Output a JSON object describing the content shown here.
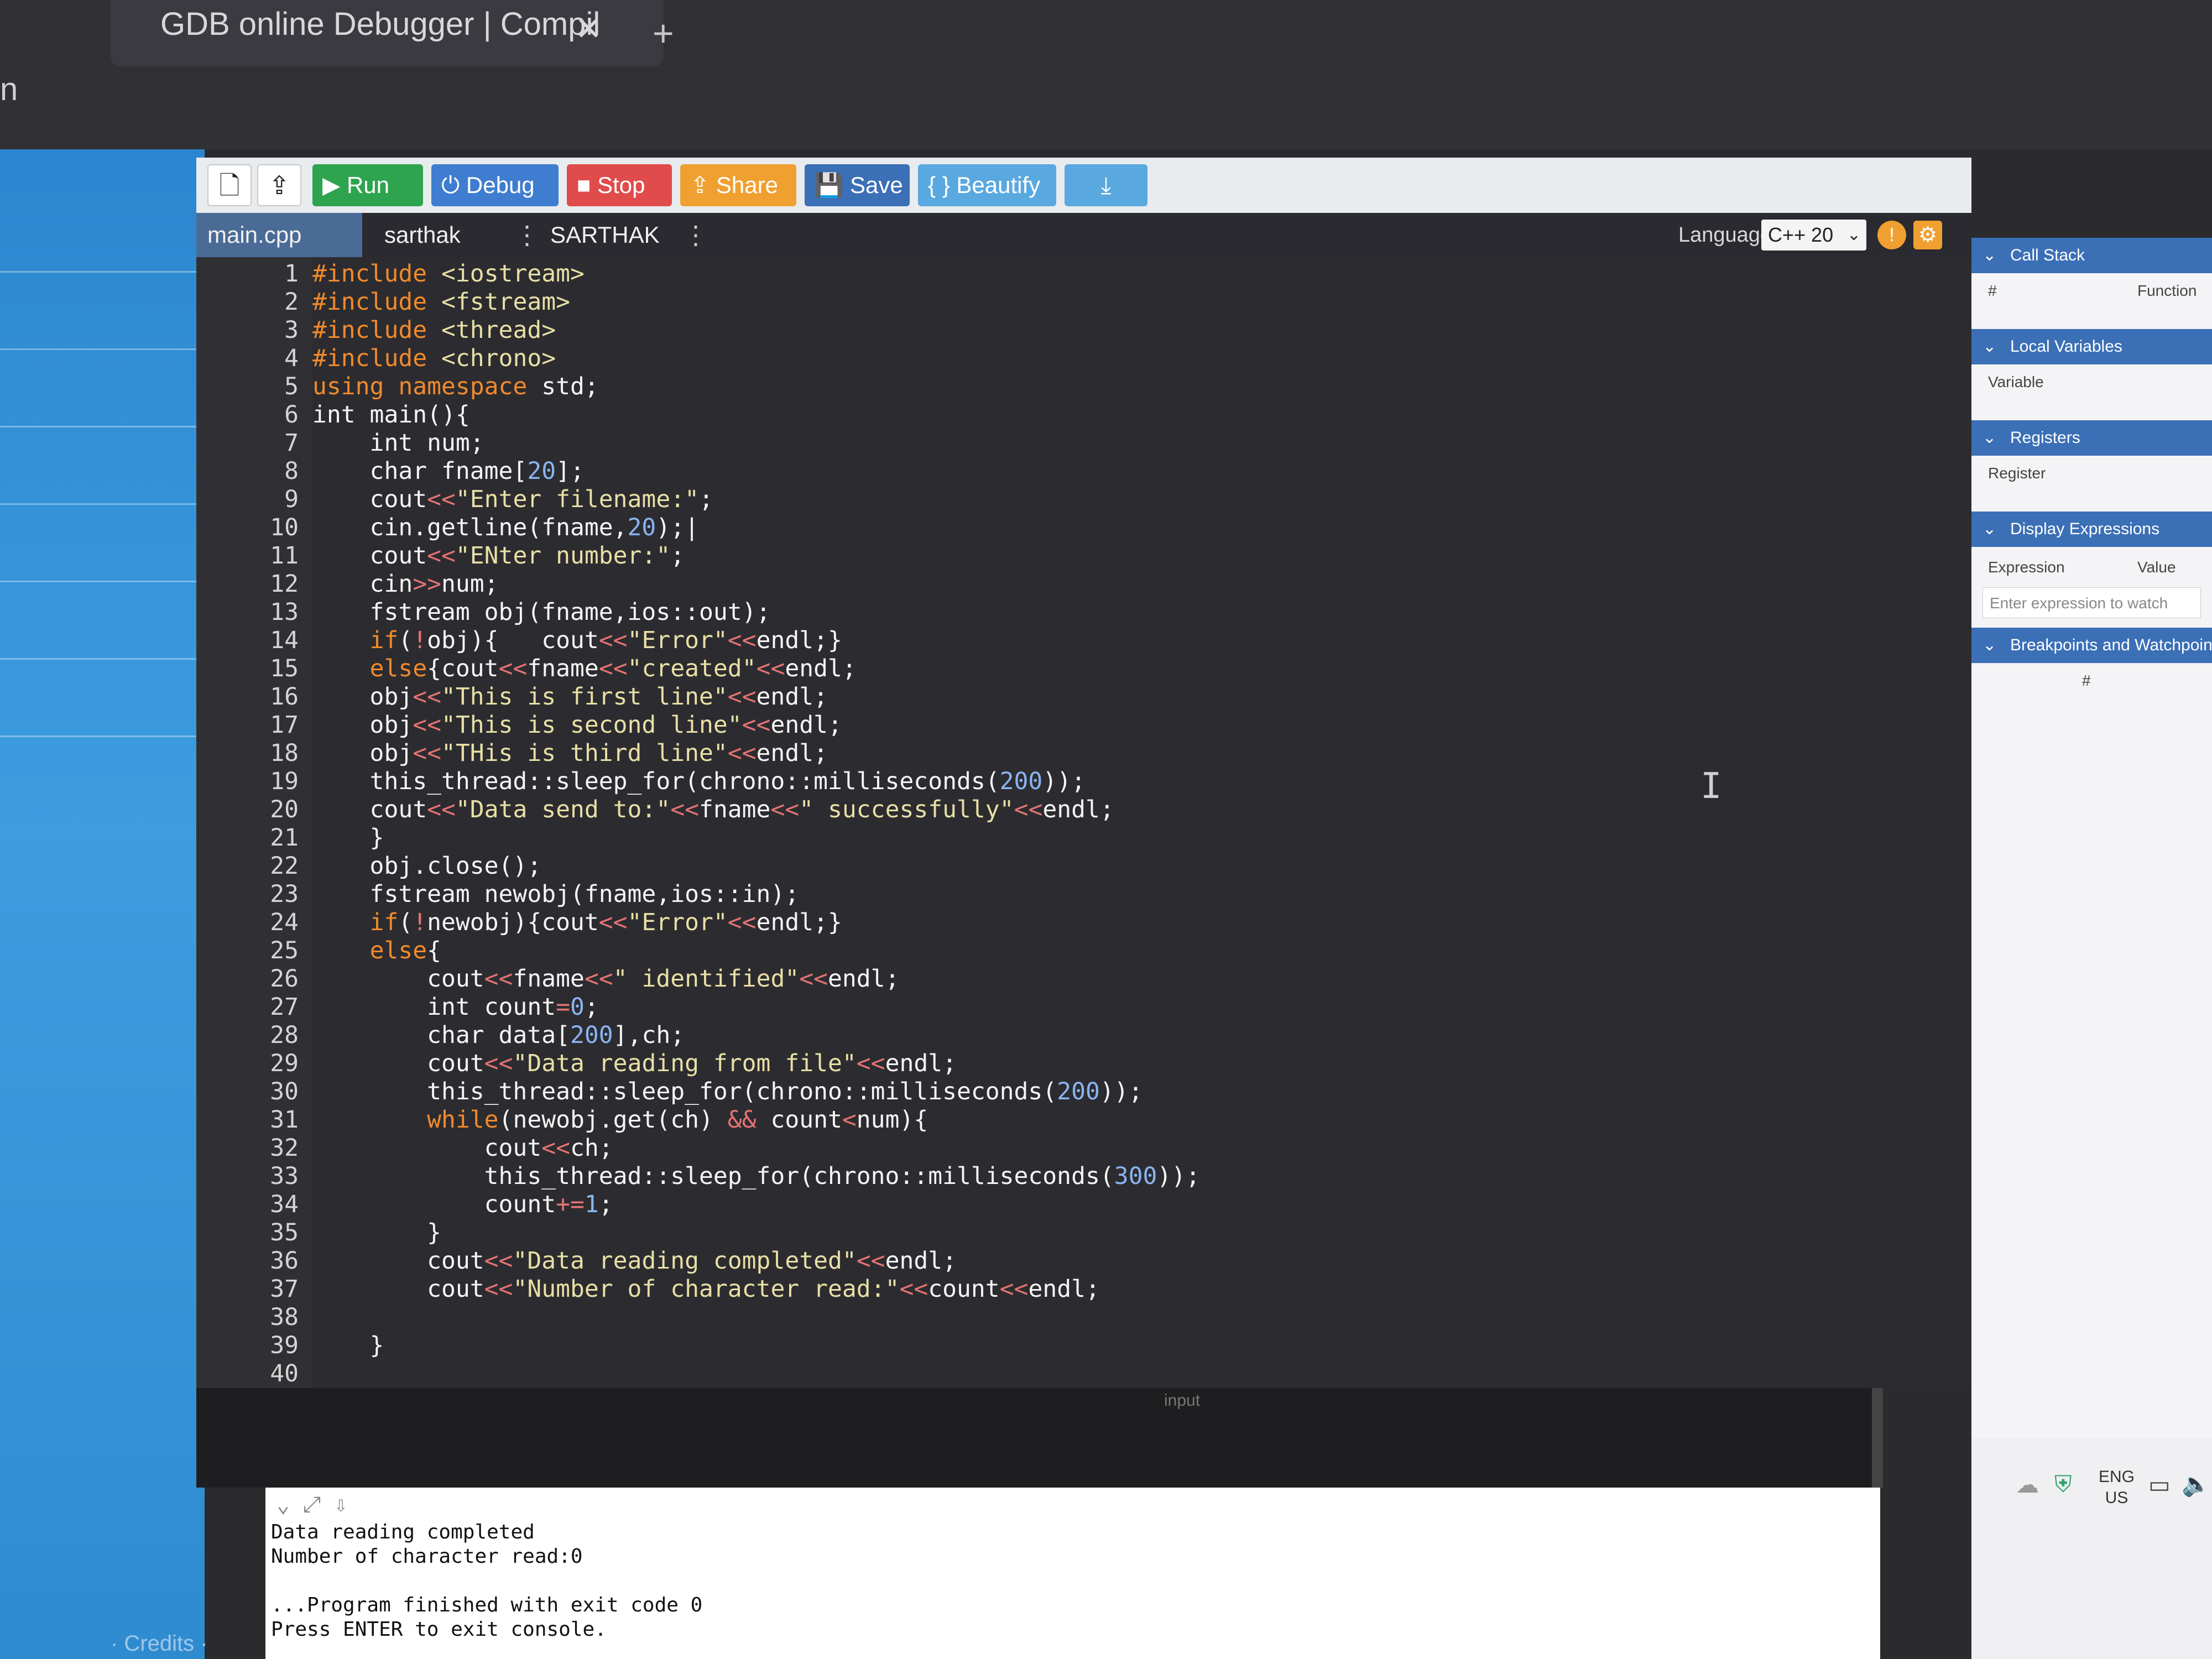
{
  "browser": {
    "tab_title": "GDB online Debugger | Compil",
    "tab_close": "✕",
    "tab_new": "+",
    "address_fragment": "n"
  },
  "toolbar": {
    "new_file_icon": "🗋",
    "upload_icon": "⇪",
    "run": "▶ Run",
    "debug": "⏻ Debug",
    "stop": "■ Stop",
    "share": "⇪ Share",
    "save": "💾 Save",
    "beautify": "{ } Beautify",
    "download": "⤓",
    "colors": {
      "run": "#2ea44f",
      "debug": "#3f7dd0",
      "stop": "#e04b4b",
      "share": "#f0a030",
      "save": "#3b6fb6",
      "beautify": "#5aa8e0",
      "download": "#5aa8e0"
    }
  },
  "tabs": {
    "main": "main.cpp",
    "second": "sarthak",
    "third": "SARTHAK",
    "menu": "⋮"
  },
  "language": {
    "label": "Language",
    "value": "C++ 20",
    "arrow": "⌄",
    "info_icon": "!",
    "settings_icon": "⚙"
  },
  "editor": {
    "line_numbers": [
      "1",
      "2",
      "3",
      "4",
      "5",
      "6",
      "7",
      "8",
      "9",
      "10",
      "11",
      "12",
      "13",
      "14",
      "15",
      "16",
      "17",
      "18",
      "19",
      "20",
      "21",
      "22",
      "23",
      "24",
      "25",
      "26",
      "27",
      "28",
      "29",
      "30",
      "31",
      "32",
      "33",
      "34",
      "35",
      "36",
      "37",
      "38",
      "39",
      "40"
    ],
    "cursor_glyph": "I"
  },
  "input_bar": {
    "label": "input"
  },
  "console": {
    "tools": "⌄  ⤢  ⇩",
    "lines": [
      "Data reading completed",
      "Number of character read:0",
      "",
      "...Program finished with exit code 0",
      "Press ENTER to exit console."
    ]
  },
  "left_sidebar": {
    "collapse_arrow": "<",
    "credits": "· Credits ·"
  },
  "debugger": {
    "call_stack": "Call Stack",
    "call_stack_cols": [
      "#",
      "Function"
    ],
    "local_variables": "Local Variables",
    "local_variables_col": "Variable",
    "registers": "Registers",
    "registers_col": "Register",
    "display_expressions": "Display Expressions",
    "display_cols": [
      "Expression",
      "Value"
    ],
    "watch_placeholder": "Enter expression to watch",
    "breakpoints": "Breakpoints and Watchpoints",
    "breakpoints_col": "#",
    "chevron": "⌄"
  },
  "tray": {
    "lang_top": "ENG",
    "lang_bottom": "US",
    "shield": "⛨",
    "cloud": "☁",
    "notif": "▭",
    "sound": "🔈"
  }
}
